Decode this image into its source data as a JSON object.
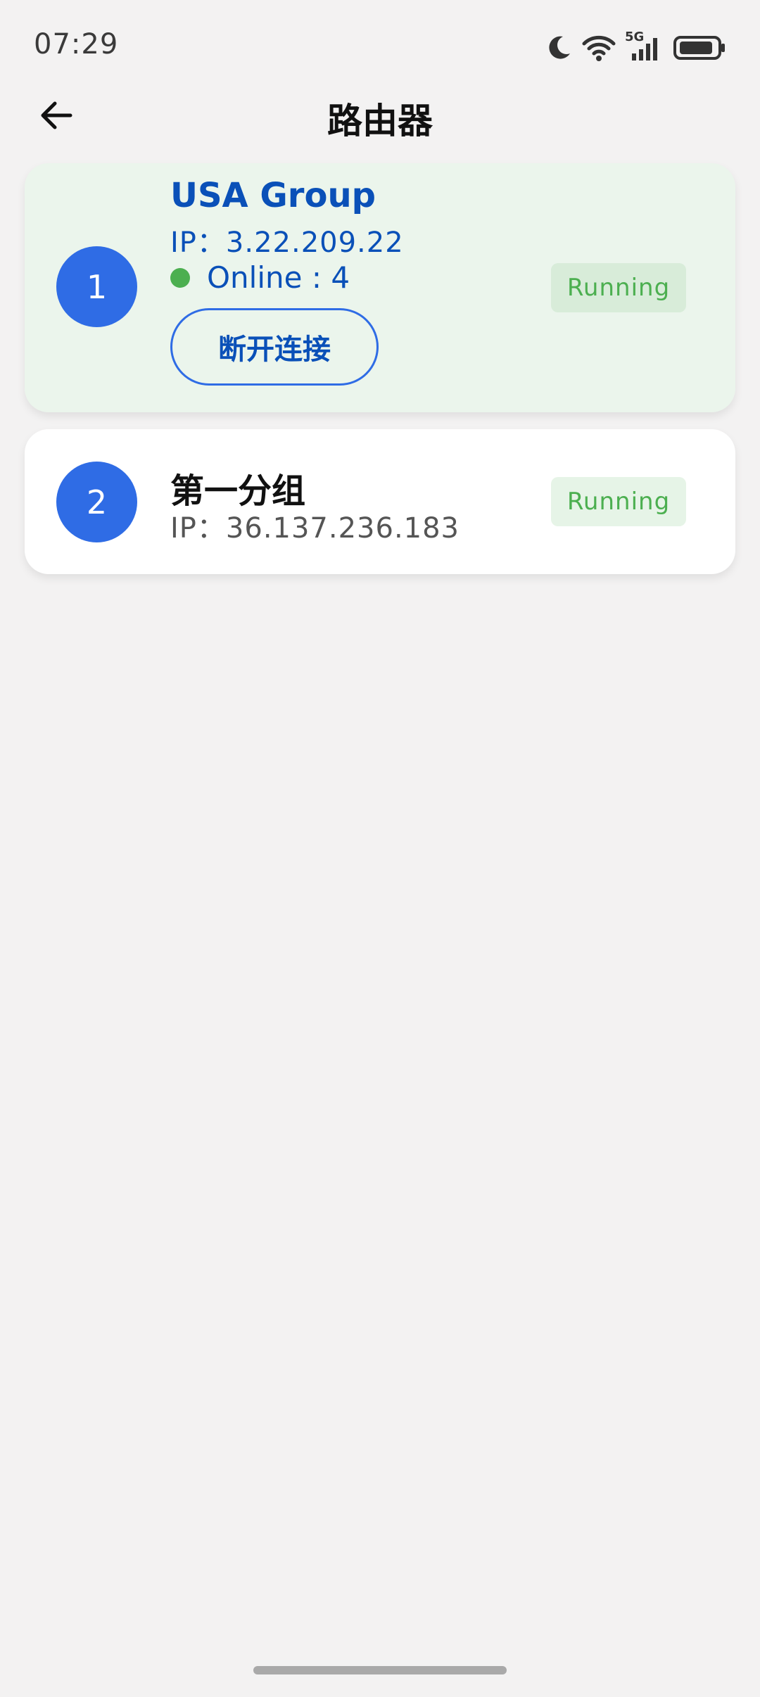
{
  "status_bar": {
    "time": "07:29",
    "network_label": "5G",
    "icons": [
      "moon-icon",
      "wifi-icon",
      "cellular-signal-icon",
      "battery-icon"
    ]
  },
  "header": {
    "title": "路由器",
    "back_icon": "arrow-left-icon"
  },
  "groups": [
    {
      "index": "1",
      "name": "USA Group",
      "ip": "IP：3.22.209.22",
      "online": "Online : 4",
      "action_label": "断开连接",
      "status": "Running",
      "active": true
    },
    {
      "index": "2",
      "name": "第一分组",
      "ip": "IP：36.137.236.183",
      "status": "Running",
      "active": false
    }
  ],
  "colors": {
    "accent": "#2f6ce5",
    "accent_text": "#0a50b8",
    "active_card_bg": "#ebf5ec",
    "status_green": "#4caf50",
    "background": "#f3f2f2"
  }
}
